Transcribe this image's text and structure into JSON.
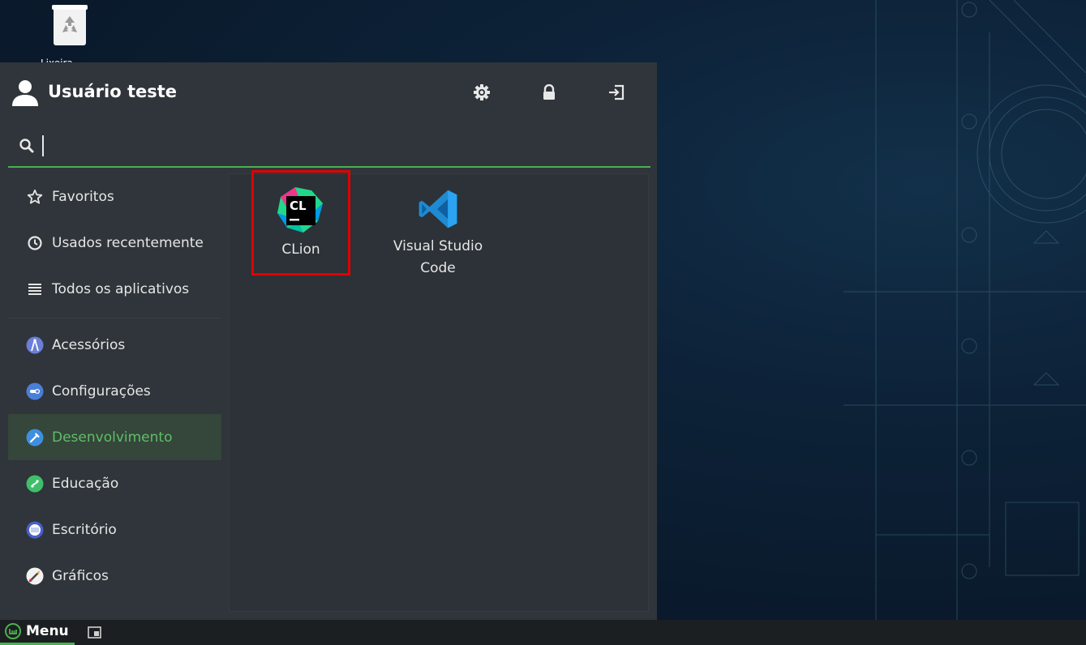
{
  "desktop": {
    "trash_label": "Lixeira"
  },
  "menu": {
    "user": {
      "name": "Usuário teste"
    },
    "header_buttons": [
      {
        "icon": "gear-icon",
        "tooltip": "settings"
      },
      {
        "icon": "lock-icon",
        "tooltip": "lock"
      },
      {
        "icon": "logout-icon",
        "tooltip": "logout"
      }
    ],
    "search": {
      "value": "",
      "placeholder": ""
    },
    "sidebar": {
      "items": [
        {
          "label": "Favoritos",
          "icon": "star-icon"
        },
        {
          "label": "Usados recentemente",
          "icon": "clock-icon"
        },
        {
          "label": "Todos os aplicativos",
          "icon": "list-icon"
        },
        {
          "label": "Acessórios",
          "icon": "accessories-icon"
        },
        {
          "label": "Configurações",
          "icon": "settings-category-icon"
        },
        {
          "label": "Desenvolvimento",
          "icon": "development-icon",
          "active": true
        },
        {
          "label": "Educação",
          "icon": "education-icon"
        },
        {
          "label": "Escritório",
          "icon": "office-icon"
        },
        {
          "label": "Gráficos",
          "icon": "graphics-icon"
        }
      ]
    },
    "apps": [
      {
        "label": "CLion",
        "icon": "clion-icon",
        "highlighted": true
      },
      {
        "label": "Visual Studio Code",
        "icon": "vscode-icon"
      }
    ]
  },
  "taskbar": {
    "menu_label": "Menu"
  },
  "colors": {
    "accent": "#4caf50",
    "menu_bg": "#2f353a",
    "active_item_bg": "#35463a",
    "active_item_text": "#5fbf6a",
    "highlight_box": "#e00000",
    "desktop_bg": "#0b1b2f"
  }
}
